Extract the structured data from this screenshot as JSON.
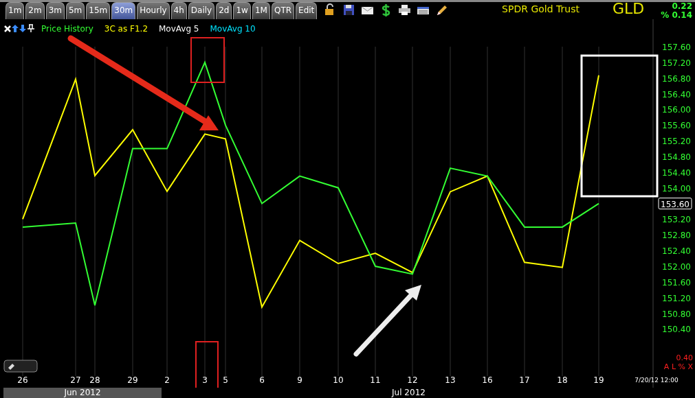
{
  "toolbar": {
    "tabs": [
      {
        "label": "1m",
        "selected": false
      },
      {
        "label": "2m",
        "selected": false
      },
      {
        "label": "3m",
        "selected": false
      },
      {
        "label": "5m",
        "selected": false
      },
      {
        "label": "15m",
        "selected": false
      },
      {
        "label": "30m",
        "selected": true
      },
      {
        "label": "Hourly",
        "selected": false
      },
      {
        "label": "4h",
        "selected": false
      },
      {
        "label": "Daily",
        "selected": false
      },
      {
        "label": "2d",
        "selected": false
      },
      {
        "label": "1w",
        "selected": false
      },
      {
        "label": "1M",
        "selected": false
      },
      {
        "label": "QTR",
        "selected": false
      },
      {
        "label": "Edit",
        "selected": false
      }
    ],
    "title": "SPDR Gold Trust",
    "symbol": "GLD",
    "change": "0.22",
    "change_percent": "% 0.14"
  },
  "legend": [
    {
      "label": "MovAvg 5",
      "color": "#ffffff"
    },
    {
      "label": "MovAvg 10",
      "color": "#00e5ff"
    }
  ],
  "chart": {
    "last_price": "153.60",
    "scale_reading": "0.40",
    "scale_controls": "A L % X",
    "last_time": "7/20/12 12:00",
    "months": [
      {
        "label": "Jun 2012",
        "selected": true
      },
      {
        "label": "Jul 2012",
        "selected": false
      }
    ],
    "chart_data": {
      "type": "line",
      "grid": true,
      "categories": [
        "26",
        "27",
        "28",
        "29",
        "2",
        "3",
        "5",
        "6",
        "9",
        "10",
        "11",
        "12",
        "13",
        "16",
        "17",
        "18",
        "19"
      ],
      "series": [
        {
          "name": "Price History",
          "color": "#33ff33",
          "values": [
            153.0,
            153.1,
            151.0,
            155.0,
            155.0,
            157.2,
            155.6,
            153.6,
            154.3,
            154.0,
            152.0,
            151.8,
            154.5,
            154.3,
            153.0,
            153.0,
            153.6
          ]
        },
        {
          "name": "3C as F1.2",
          "color": "#ffff00",
          "values": [
            153.2,
            156.77,
            154.31,
            155.48,
            153.91,
            155.37,
            155.25,
            150.96,
            152.66,
            152.07,
            152.33,
            151.84,
            153.9,
            154.3,
            152.1,
            151.97,
            156.87
          ]
        }
      ],
      "ylim": [
        149.2,
        158.3
      ],
      "yticks": [
        {
          "value": 157.6,
          "label": "157.60"
        },
        {
          "value": 157.2,
          "label": "157.20"
        },
        {
          "value": 156.8,
          "label": "156.80"
        },
        {
          "value": 156.4,
          "label": "156.40"
        },
        {
          "value": 156.0,
          "label": "156.00"
        },
        {
          "value": 155.6,
          "label": "155.60"
        },
        {
          "value": 155.2,
          "label": "155.20"
        },
        {
          "value": 154.8,
          "label": "154.80"
        },
        {
          "value": 154.4,
          "label": "154.40"
        },
        {
          "value": 154.0,
          "label": "154.00"
        },
        {
          "value": 153.2,
          "label": "153.20"
        },
        {
          "value": 152.8,
          "label": "152.80"
        },
        {
          "value": 152.4,
          "label": "152.40"
        },
        {
          "value": 152.0,
          "label": "152.00"
        },
        {
          "value": 151.6,
          "label": "151.60"
        },
        {
          "value": 151.2,
          "label": "151.20"
        },
        {
          "value": 150.8,
          "label": "150.80"
        },
        {
          "value": 150.4,
          "label": "150.40"
        }
      ]
    }
  }
}
